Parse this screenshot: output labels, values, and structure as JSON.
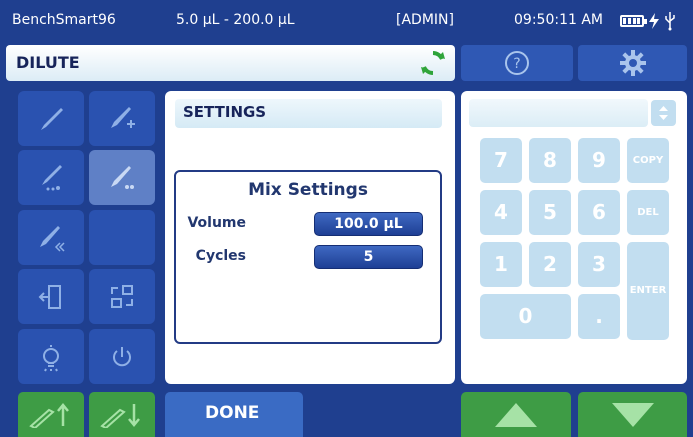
{
  "status": {
    "device": "BenchSmart96",
    "range": "5.0 µL - 200.0 µL",
    "user": "[ADMIN]",
    "time": "09:50:11 AM"
  },
  "mode": {
    "label": "DILUTE"
  },
  "settings": {
    "header": "SETTINGS",
    "mix_title": "Mix Settings",
    "volume_label": "Volume",
    "volume_value": "100.0 µL",
    "cycles_label": "Cycles",
    "cycles_value": "5"
  },
  "keypad": {
    "keys": [
      "7",
      "8",
      "9",
      "COPY",
      "4",
      "5",
      "6",
      "DEL",
      "1",
      "2",
      "3",
      "ENTER",
      "0",
      "."
    ]
  },
  "bottom": {
    "done_label": "DONE"
  },
  "colors": {
    "background": "#1f3f8f",
    "accent_green": "#3e9c45",
    "keypad_key": "#c2def0",
    "refresh_green": "#2fa43a"
  }
}
